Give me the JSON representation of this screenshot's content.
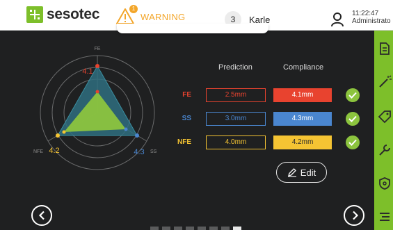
{
  "header": {
    "brand": "sesotec",
    "warning_label": "WARNING",
    "warning_count": "1",
    "user_count": "3",
    "user_name": "Karle",
    "time": "11:22:47",
    "role": "Administrato"
  },
  "radar": {
    "axes": [
      {
        "label": "FE",
        "value": "4.1"
      },
      {
        "label": "SS",
        "value": "4.3"
      },
      {
        "label": "NFE",
        "value": "4.2"
      }
    ]
  },
  "table": {
    "prediction_header": "Prediction",
    "compliance_header": "Compliance",
    "rows": [
      {
        "label": "FE",
        "prediction": "2.5mm",
        "compliance": "4.1mm",
        "color": "#e8432f"
      },
      {
        "label": "SS",
        "prediction": "3.0mm",
        "compliance": "4.3mm",
        "color": "#4a86cf"
      },
      {
        "label": "NFE",
        "prediction": "4.0mm",
        "compliance": "4.2mm",
        "color": "#f5c433"
      }
    ]
  },
  "actions": {
    "edit_label": "Edit"
  },
  "colors": {
    "accent_green": "#7dbf2a",
    "warning": "#f3a62a",
    "background": "#1f2021"
  },
  "sidebar": {
    "icons": [
      "document-icon",
      "magic-wand-icon",
      "tag-icon",
      "wrench-icon",
      "shield-icon",
      "list-icon"
    ]
  },
  "pager": {
    "pages": 8,
    "active_page": 8
  }
}
